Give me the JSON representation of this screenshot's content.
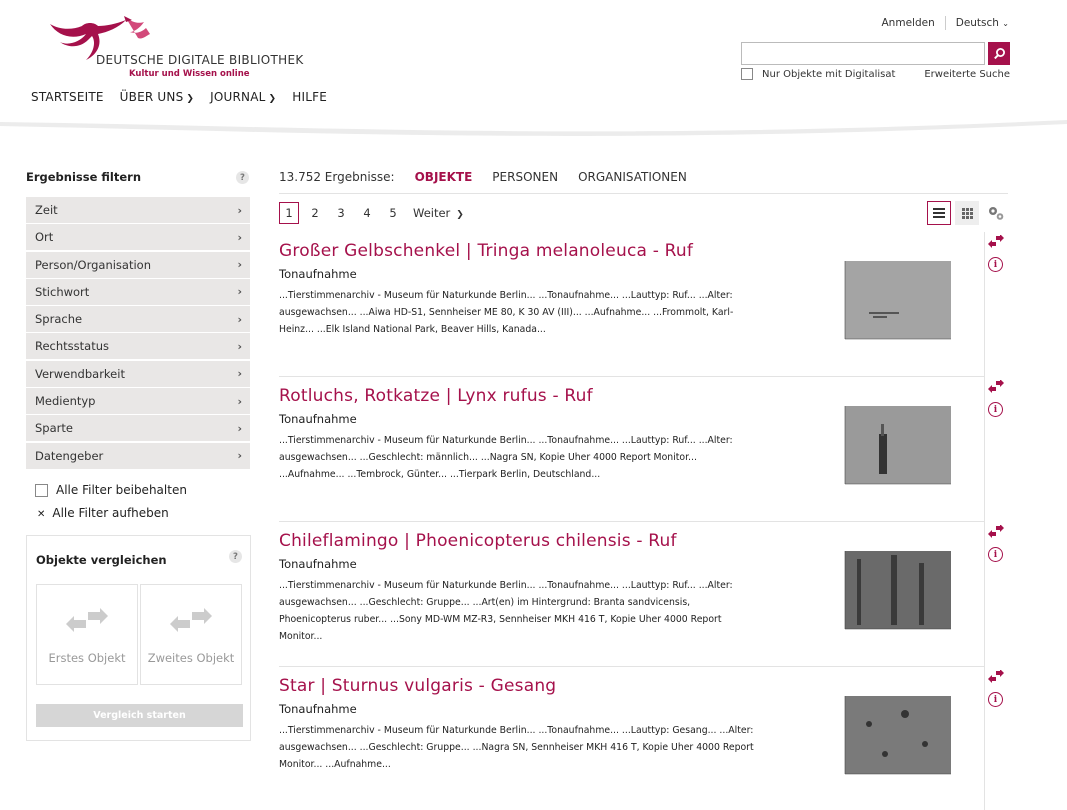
{
  "brand": {
    "name": "DEUTSCHE DIGITALE BIBLIOTHEK",
    "tagline": "Kultur und Wissen online",
    "accent": "#a5114b"
  },
  "nav": {
    "items": [
      {
        "label": "STARTSEITE"
      },
      {
        "label": "ÜBER UNS"
      },
      {
        "label": "JOURNAL"
      },
      {
        "label": "HILFE"
      }
    ]
  },
  "toplinks": {
    "login": "Anmelden",
    "language": "Deutsch"
  },
  "search": {
    "value": "",
    "digitized_only_label": "Nur Objekte mit Digitalisat",
    "advanced_label": "Erweiterte Suche"
  },
  "filters": {
    "heading": "Ergebnisse filtern",
    "help": "?",
    "items": [
      {
        "label": "Zeit"
      },
      {
        "label": "Ort"
      },
      {
        "label": "Person/Organisation"
      },
      {
        "label": "Stichwort"
      },
      {
        "label": "Sprache"
      },
      {
        "label": "Rechtsstatus"
      },
      {
        "label": "Verwendbarkeit"
      },
      {
        "label": "Medientyp"
      },
      {
        "label": "Sparte"
      },
      {
        "label": "Datengeber"
      }
    ],
    "keep_label": "Alle Filter beibehalten",
    "clear_label": "Alle Filter aufheben"
  },
  "compare": {
    "title": "Objekte vergleichen",
    "help": "?",
    "first_label": "Erstes Objekt",
    "second_label": "Zweites Objekt",
    "button_label": "Vergleich starten"
  },
  "results": {
    "count_label": "13.752 Ergebnisse:",
    "tabs": [
      {
        "label": "OBJEKTE"
      },
      {
        "label": "PERSONEN"
      },
      {
        "label": "ORGANISATIONEN"
      }
    ],
    "pages": [
      "1",
      "2",
      "3",
      "4",
      "5"
    ],
    "next_label": "Weiter",
    "items": [
      {
        "title": "Großer Gelbschenkel | Tringa melanoleuca - Ruf",
        "type": "Tonaufnahme",
        "snippet": "...Tierstimmenarchiv - Museum für Naturkunde Berlin... ...Tonaufnahme... ...Lauttyp: Ruf... ...Alter: ausgewachsen... ...Aiwa HD-S1, Sennheiser ME 80, K 30 AV (III)... ...Aufnahme... ...Frommolt, Karl-Heinz... ...Elk Island National Park, Beaver Hills, Kanada..."
      },
      {
        "title": "Rotluchs, Rotkatze | Lynx rufus - Ruf",
        "type": "Tonaufnahme",
        "snippet": "...Tierstimmenarchiv - Museum für Naturkunde Berlin... ...Tonaufnahme... ...Lauttyp: Ruf... ...Alter: ausgewachsen... ...Geschlecht: männlich... ...Nagra SN, Kopie Uher 4000 Report Monitor... ...Aufnahme... ...Tembrock, Günter... ...Tierpark Berlin, Deutschland..."
      },
      {
        "title": "Chileflamingo | Phoenicopterus chilensis - Ruf",
        "type": "Tonaufnahme",
        "snippet": "...Tierstimmenarchiv - Museum für Naturkunde Berlin... ...Tonaufnahme... ...Lauttyp: Ruf... ...Alter: ausgewachsen... ...Geschlecht: Gruppe... ...Art(en) im Hintergrund: Branta sandvicensis, Phoenicopterus ruber... ...Sony MD-WM MZ-R3, Sennheiser MKH 416 T, Kopie Uher 4000 Report Monitor..."
      },
      {
        "title": "Star | Sturnus vulgaris - Gesang",
        "type": "Tonaufnahme",
        "snippet": "...Tierstimmenarchiv - Museum für Naturkunde Berlin... ...Tonaufnahme... ...Lauttyp: Gesang... ...Alter: ausgewachsen... ...Geschlecht: Gruppe... ...Nagra SN, Sennheiser MKH 416 T, Kopie Uher 4000 Report Monitor... ...Aufnahme..."
      }
    ]
  }
}
